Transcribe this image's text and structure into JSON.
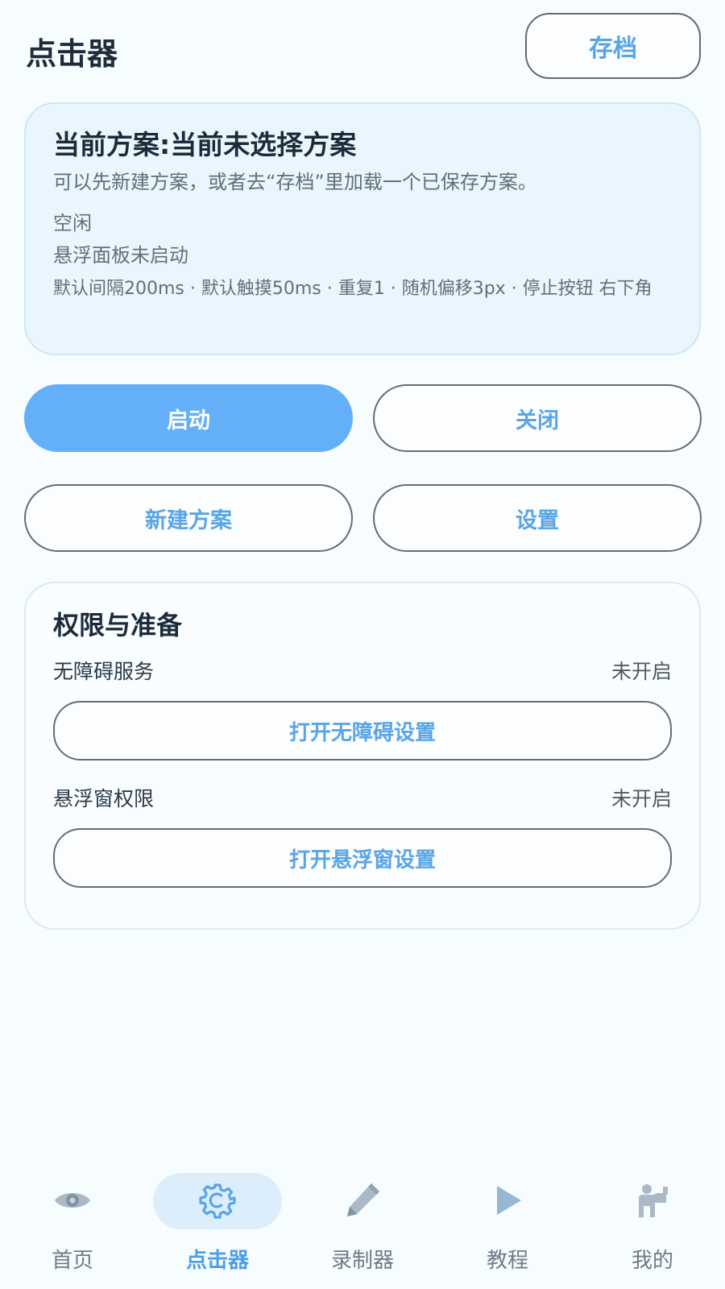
{
  "header": {
    "title": "点击器",
    "archive_label": "存档"
  },
  "scheme": {
    "title": "当前方案:当前未选择方案",
    "hint": "可以先新建方案，或者去“存档”里加载一个已保存方案。",
    "status_idle": "空闲",
    "status_panel": "悬浮面板未启动",
    "params": "默认间隔200ms · 默认触摸50ms · 重复1 · 随机偏移3px · 停止按钮 右下角"
  },
  "actions": {
    "start": "启动",
    "close": "关闭",
    "new_scheme": "新建方案",
    "settings": "设置"
  },
  "permissions": {
    "title": "权限与准备",
    "items": [
      {
        "label": "无障碍服务",
        "state": "未开启",
        "button": "打开无障碍设置"
      },
      {
        "label": "悬浮窗权限",
        "state": "未开启",
        "button": "打开悬浮窗设置"
      }
    ]
  },
  "nav": {
    "items": [
      {
        "label": "首页",
        "icon": "eye-icon",
        "active": false
      },
      {
        "label": "点击器",
        "icon": "gear-icon",
        "active": true
      },
      {
        "label": "录制器",
        "icon": "pencil-icon",
        "active": false
      },
      {
        "label": "教程",
        "icon": "play-icon",
        "active": false
      },
      {
        "label": "我的",
        "icon": "person-icon",
        "active": false
      }
    ]
  },
  "colors": {
    "accent": "#5aa5e6",
    "primary_button": "#63b0f8",
    "card_background": "#eaf6fd",
    "nav_active_pill": "#dceefb"
  }
}
